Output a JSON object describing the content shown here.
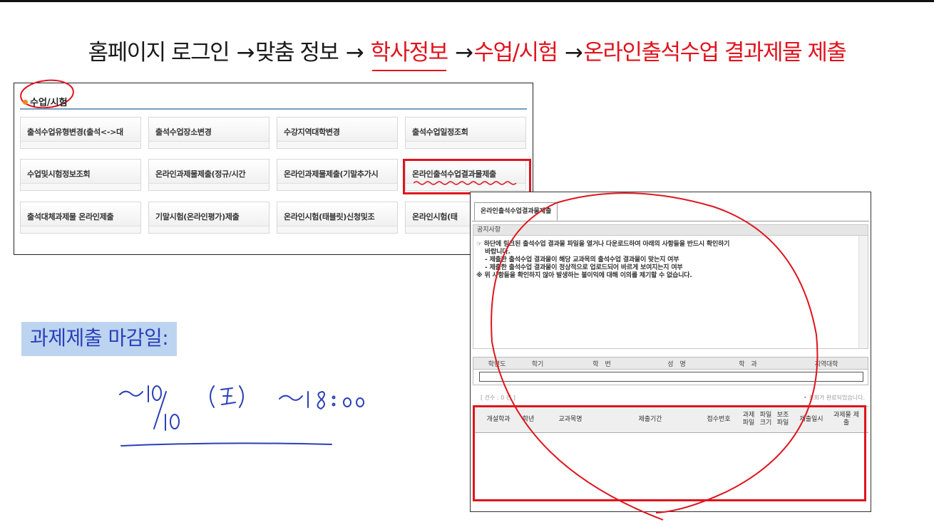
{
  "headline": {
    "step1": "홈페이지 로그인",
    "step2": "맞춤 정보",
    "step3": "학사정보",
    "step4": "수업/시험",
    "step5": "온라인출석수업 결과제물 제출",
    "arrow": "→"
  },
  "menu_panel": {
    "title": "수업/시험",
    "items": [
      "출석수업유형변경(출석<->대",
      "출석수업장소변경",
      "수강지역대학변경",
      "출석수업일정조회",
      "수업및시험정보조회",
      "온라인과제물제출(정규/시간",
      "온라인과제물제출(기말추가시",
      "온라인출석수업결과물제출",
      "출석대체과제물 온라인제출",
      "기말시험(온라인평가)제출",
      "온라인시험(태블릿)신청및조",
      "온라인시험(태"
    ]
  },
  "deadline": {
    "label": "과제제출 마감일:"
  },
  "submit_panel": {
    "tab": "온라인출석수업결과물제출",
    "notice_header": "공지사항",
    "notice_lines": [
      "☞ 하단에 링크된 출석수업 결과물 파일을 열거나 다운로드하여 아래의 사항들을 반드시 확인하기",
      "바랍니다.",
      "- 제출한 출석수업 결과물이 해당 교과목의 출석수업 결과물이 맞는지 여부",
      "- 제출한 출석수업 결과물이 정상적으로 업로드되어 바르게 보여지는지 여부",
      "※ 위 사항들을 확인하지 않아 발생하는 불이익에 대해 이의를 제기할 수 없습니다."
    ],
    "info_headers": [
      "학년도",
      "학기",
      "학　번",
      "성　명",
      "학　과",
      "지역대학"
    ],
    "count": "[ 건수 : 0 건 ]",
    "status": "• 조회가 완료되었습니다.",
    "result_headers": [
      "개설학과",
      "학년",
      "교과목명",
      "제출기간",
      "접수번호",
      "과제 파일",
      "파일 크기",
      "보조 파일",
      "제출일시",
      "과제물 제　출"
    ]
  },
  "colors": {
    "accent_red": "#e0141e",
    "deadline_bg": "#bcd4f0",
    "deadline_text": "#2a3fb8",
    "menu_line": "#7a9cc0"
  }
}
